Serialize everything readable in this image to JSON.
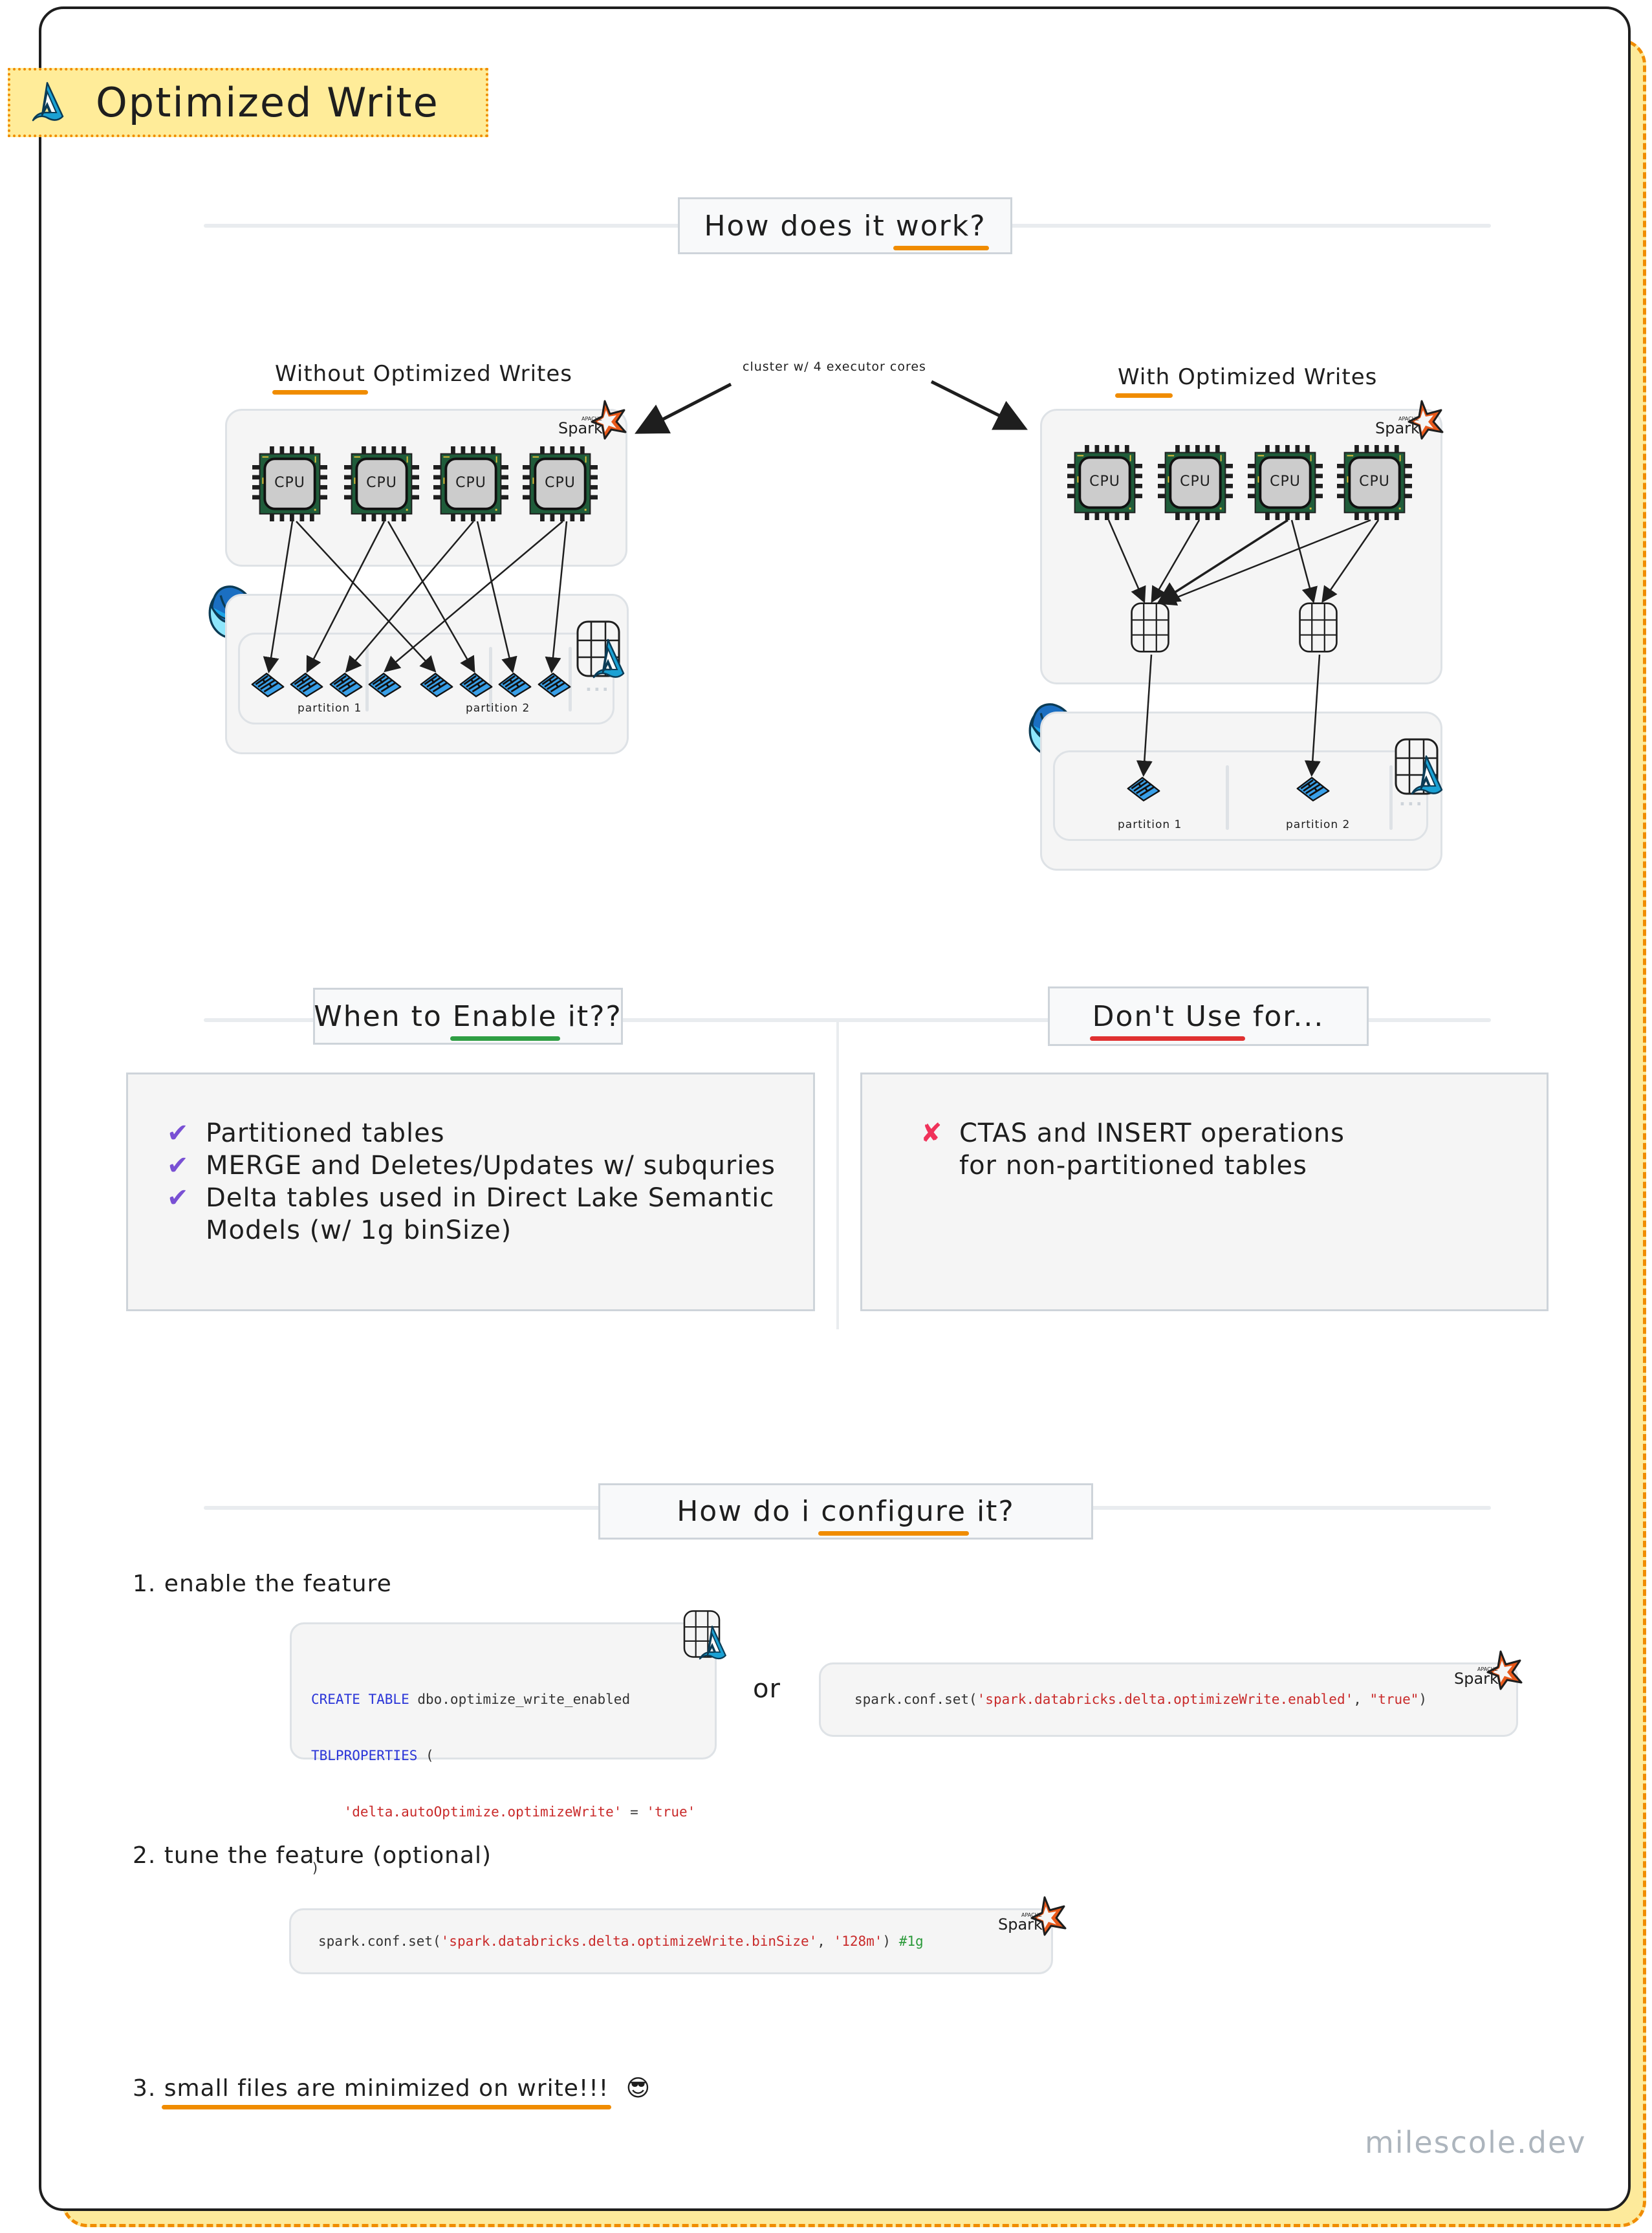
{
  "title": "Optimized Write",
  "colors": {
    "accent_orange": "#f08c00",
    "banner_yellow": "#ffec99",
    "spark_orange": "#e8591a",
    "delta_blue": "#1ba1d4",
    "check_purple": "#7950d4",
    "cross_red": "#f0325a",
    "enable_green": "#2f9e44",
    "dont_red": "#e03131",
    "cpu_green": "#1f5c3a"
  },
  "how_it_works": {
    "heading_pre": "How does it ",
    "heading_ul": "work?",
    "cluster_note": "cluster w/ 4 executor cores",
    "without": {
      "label_ul": "Without",
      "label_rest": " Optimized Writes",
      "cpus": [
        "CPU",
        "CPU",
        "CPU",
        "CPU"
      ],
      "partitions": [
        "partition 1",
        "partition 2"
      ],
      "files_per_partition": 4,
      "more": "..."
    },
    "with": {
      "label_ul": "With",
      "label_rest": " Optimized Writes",
      "cpus": [
        "CPU",
        "CPU",
        "CPU",
        "CPU"
      ],
      "partitions": [
        "partition 1",
        "partition 2"
      ],
      "files_per_partition": 1,
      "more": "..."
    },
    "spark_logo": {
      "small": "APACHE",
      "big": "Spark"
    }
  },
  "when_enable": {
    "heading_pre": "When to ",
    "heading_ul": "Enable",
    "heading_post": " it??",
    "items": [
      "Partitioned tables",
      "MERGE and Deletes/Updates w/ subquries",
      "Delta tables used in Direct Lake Semantic Models (w/ 1g binSize)"
    ]
  },
  "dont_use": {
    "heading_ul": "Don't Use",
    "heading_post": " for...",
    "items": [
      "CTAS and INSERT operations for non-partitioned tables"
    ]
  },
  "configure": {
    "heading_pre": "How do i ",
    "heading_ul": "configure",
    "heading_post": " it?",
    "step1": "1. enable the feature",
    "sql": {
      "l1_kw": "CREATE TABLE",
      "l1_rest": " dbo.optimize_write_enabled",
      "l2_kw": "TBLPROPERTIES",
      "l2_rest": " (",
      "l3_key": "'delta.autoOptimize.optimizeWrite'",
      "l3_op": " = ",
      "l3_val": "'true'",
      "l4": ")"
    },
    "or": "or",
    "pyspark_enable": {
      "pre": "spark.conf.set(",
      "key": "'spark.databricks.delta.optimizeWrite.enabled'",
      "sep": ", ",
      "val": "\"true\"",
      "post": ")"
    },
    "step2": "2. tune the feature (optional)",
    "pyspark_tune": {
      "pre": "spark.conf.set(",
      "key": "'spark.databricks.delta.optimizeWrite.binSize'",
      "sep": ", ",
      "val": "'128m'",
      "post": ") ",
      "comment": "#1g"
    },
    "step3_num": "3. ",
    "step3_ul": "small files are minimized on write!!!",
    "step3_emoji": "😎"
  },
  "watermark": "milescole.dev"
}
